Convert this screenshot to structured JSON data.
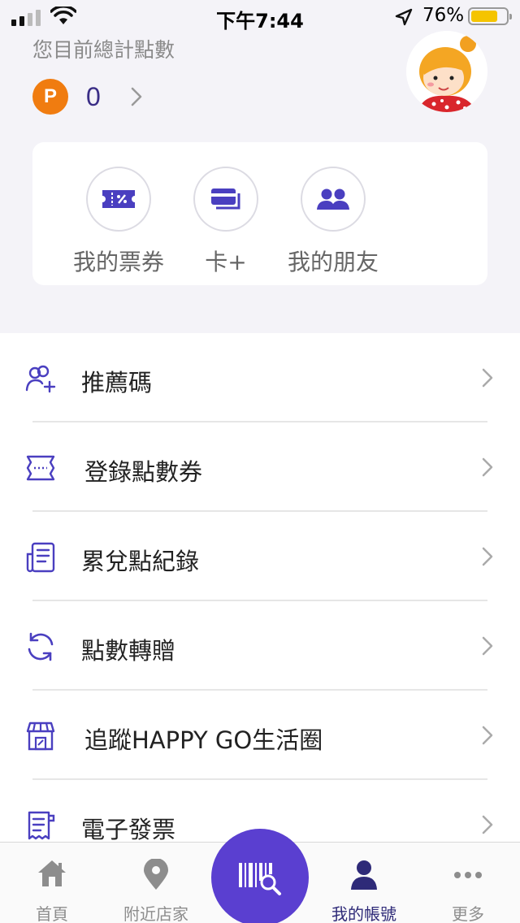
{
  "status_bar": {
    "time": "下午7:44",
    "battery_percent": "76%",
    "battery_level": 0.76
  },
  "header": {
    "points_title": "您目前總計點數",
    "points_badge": "P",
    "points_value": "0"
  },
  "quick_actions": [
    {
      "label": "我的票券",
      "icon": "ticket-icon"
    },
    {
      "label": "卡+",
      "icon": "card-icon"
    },
    {
      "label": "我的朋友",
      "icon": "friends-icon"
    }
  ],
  "menu": [
    {
      "label": "推薦碼",
      "icon": "add-user-icon"
    },
    {
      "label": "登錄點數券",
      "icon": "coupon-icon"
    },
    {
      "label": "累兌點紀錄",
      "icon": "record-icon"
    },
    {
      "label": "點數轉贈",
      "icon": "transfer-icon"
    },
    {
      "label": "追蹤HAPPY GO生活圈",
      "icon": "store-icon"
    },
    {
      "label": "電子發票",
      "icon": "invoice-icon"
    }
  ],
  "tabbar": [
    {
      "label": "首頁",
      "icon": "home-icon"
    },
    {
      "label": "附近店家",
      "icon": "location-pin-icon"
    },
    {
      "label": "",
      "icon": "barcode-scan-icon"
    },
    {
      "label": "我的帳號",
      "icon": "user-icon",
      "active": true
    },
    {
      "label": "更多",
      "icon": "more-icon"
    }
  ],
  "colors": {
    "accent": "#5a3fd0",
    "icon_purple": "#4a3fc0",
    "points_orange": "#f07c10",
    "active_tab": "#2e2a78"
  }
}
